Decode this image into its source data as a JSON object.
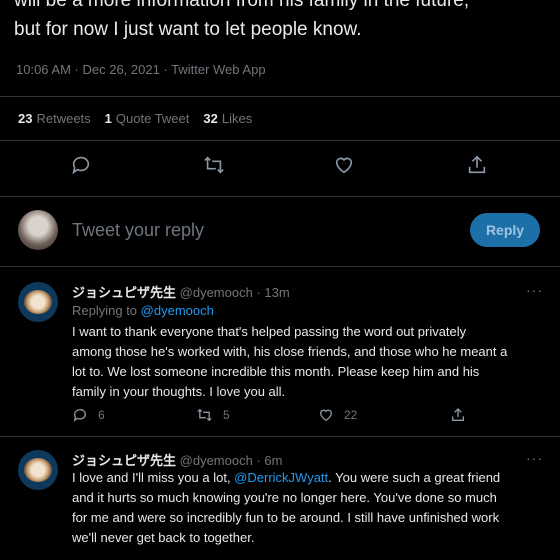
{
  "tweet": {
    "lines": [
      "will be a more information from his family in the future,",
      "but for now I just want to let people know."
    ],
    "meta": "10:06 AM · Dec 26, 2021 · Twitter Web App",
    "stats": {
      "retweets_count": "23",
      "retweets_label": "Retweets",
      "quotes_count": "1",
      "quotes_label": "Quote Tweet",
      "likes_count": "32",
      "likes_label": "Likes"
    }
  },
  "compose": {
    "placeholder": "Tweet your reply",
    "button": "Reply"
  },
  "replies": [
    {
      "name": "ジョシュピザ先生",
      "handle": "@dyemooch · 13m",
      "more": "···",
      "replying_prefix": "Replying to ",
      "replying_to": "@dyemooch",
      "lines": [
        "I want to thank everyone that's helped passing the word out privately",
        "among those he's worked with, his close friends, and those who he meant a",
        "lot to. We lost someone incredible this month. Please keep him and his",
        "family in your thoughts. I love you all."
      ],
      "reply_count": "6",
      "retweet_count": "5",
      "like_count": "22"
    },
    {
      "name": "ジョシュピザ先生",
      "handle": "@dyemooch · 6m",
      "more": "···",
      "line1_pre": "I love and I'll miss you a lot, ",
      "line1_link": "@DerrickJWyatt",
      "line1_post": ". You were such a great friend",
      "lines": [
        "and it hurts so much knowing you're no longer here. You've done so much",
        "for me and were so incredibly fun to be around. I still have unfinished work",
        "we'll never get back to together."
      ]
    }
  ],
  "colors": {
    "accent": "#1d9bf0",
    "muted": "#71767b",
    "text": "#e7e9ea",
    "divider": "#2f3336"
  }
}
